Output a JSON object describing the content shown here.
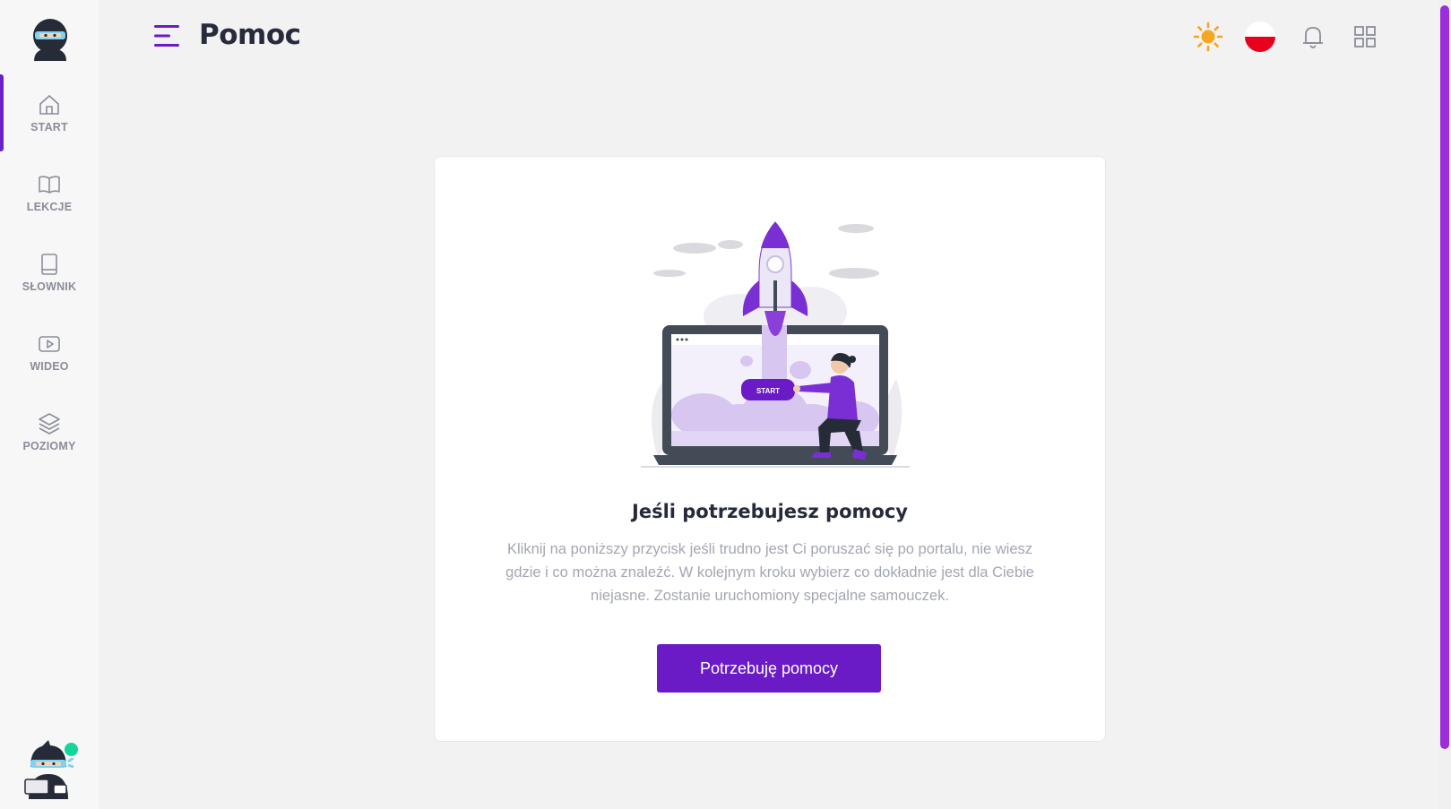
{
  "header": {
    "title": "Pomoc"
  },
  "sidebar": {
    "items": [
      {
        "label": "START",
        "icon": "home-icon"
      },
      {
        "label": "LEKCJE",
        "icon": "book-open-icon"
      },
      {
        "label": "SŁOWNIK",
        "icon": "book-icon"
      },
      {
        "label": "WIDEO",
        "icon": "video-icon"
      },
      {
        "label": "POZIOMY",
        "icon": "layers-icon"
      }
    ],
    "active": "START"
  },
  "illustration": {
    "button_text": "START"
  },
  "card": {
    "title": "Jeśli potrzebujesz pomocy",
    "text": "Kliknij na poniższy przycisk jeśli trudno jest Ci poruszać się po portalu, nie wiesz gdzie i co można znaleźć. W kolejnym kroku wybierz co dokładnie jest dla Ciebie niejasne. Zostanie uruchomiony specjalne samouczek.",
    "button": "Potrzebuję pomocy"
  },
  "colors": {
    "accent": "#6a1bc6",
    "sun": "#f5a623",
    "flag_red": "#e8001c",
    "online": "#14d69a"
  }
}
